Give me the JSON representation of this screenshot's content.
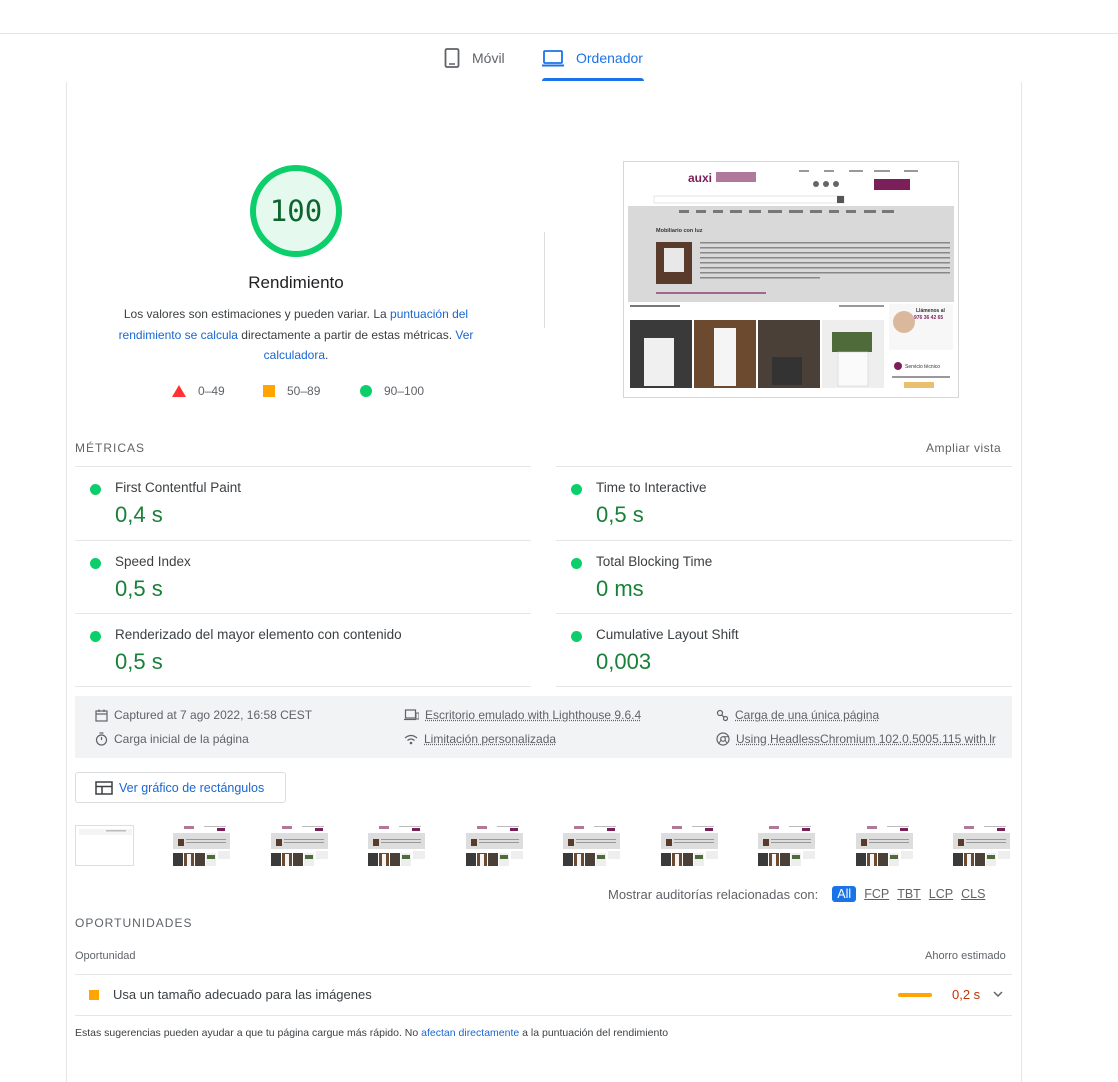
{
  "tabs": [
    {
      "label": "Móvil",
      "icon": "smartphone-icon"
    },
    {
      "label": "Ordenador",
      "icon": "laptop-icon",
      "selected": true
    }
  ],
  "performance": {
    "score": "100",
    "score_fraction": 1.0,
    "title": "Rendimiento",
    "desc_prefix": "Los valores son estimaciones y pueden variar. La ",
    "desc_link1": "puntuación del rendimiento se calcula",
    "desc_middle": " directamente a partir de estas métricas. ",
    "desc_link2": "Ver calculadora",
    "desc_suffix": ".",
    "legend": [
      {
        "range": "0–49",
        "shape": "triangle",
        "color": "#ff3333"
      },
      {
        "range": "50–89",
        "shape": "square",
        "color": "#ffa400"
      },
      {
        "range": "90–100",
        "shape": "circle",
        "color": "#0cce6b"
      }
    ],
    "colors": {
      "pass": "#0cce6b",
      "pass_fill": "#e6f9ee",
      "pass_text": "#0d652d"
    }
  },
  "metrics": {
    "section_title": "MÉTRICAS",
    "expand_label": "Ampliar vista",
    "items": [
      {
        "name": "First Contentful Paint",
        "value": "0,4 s"
      },
      {
        "name": "Time to Interactive",
        "value": "0,5 s"
      },
      {
        "name": "Speed Index",
        "value": "0,5 s"
      },
      {
        "name": "Total Blocking Time",
        "value": "0 ms"
      },
      {
        "name": "Renderizado del mayor elemento con contenido",
        "value": "0,5 s"
      },
      {
        "name": "Cumulative Layout Shift",
        "value": "0,003"
      }
    ]
  },
  "run_info": {
    "captured": "Captured at 7 ago 2022, 16:58 CEST",
    "initial_load": "Carga inicial de la página",
    "emulated": "Escritorio emulado with Lighthouse 9.6.4",
    "throttling": "Limitación personalizada",
    "single_page": "Carga de una única página",
    "browser": "Using HeadlessChromium 102.0.5005.115 with lr"
  },
  "treemap_label": "Ver gráfico de rectángulos",
  "filter": {
    "label": "Mostrar auditorías relacionadas con:",
    "chips": [
      "All",
      "FCP",
      "TBT",
      "LCP",
      "CLS"
    ],
    "active": "All"
  },
  "opportunities": {
    "section_title": "OPORTUNIDADES",
    "col_opportunity": "Oportunidad",
    "col_savings": "Ahorro estimado",
    "items": [
      {
        "label": "Usa un tamaño adecuado para las imágenes",
        "savings": "0,2 s"
      }
    ],
    "footnote_prefix": "Estas sugerencias pueden ayudar a que tu página cargue más rápido. No ",
    "footnote_link": "afectan directamente",
    "footnote_suffix": " a la puntuación del rendimiento"
  },
  "screenshot": {
    "logo": "auxi",
    "heading": "Mobiliario con luz",
    "sidebar_phone": "976 36 42 65",
    "sidebar_call": "Llámenos al",
    "sidebar_service": "Servicio técnico",
    "brand_color": "#7b1f5a"
  }
}
